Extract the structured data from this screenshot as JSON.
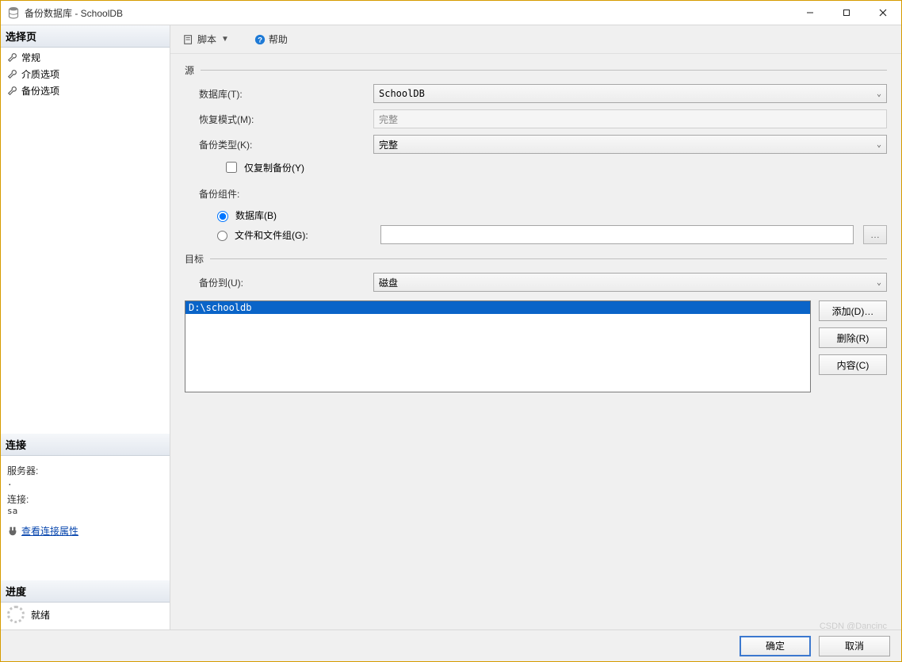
{
  "window": {
    "title": "备份数据库 - SchoolDB"
  },
  "sidebar": {
    "select_page_header": "选择页",
    "pages": [
      {
        "label": "常规"
      },
      {
        "label": "介质选项"
      },
      {
        "label": "备份选项"
      }
    ],
    "connection_header": "连接",
    "server_label": "服务器:",
    "server_value": ".",
    "connection_label": "连接:",
    "connection_value": "sa",
    "view_conn_props": "查看连接属性",
    "progress_header": "进度",
    "progress_status": "就绪"
  },
  "toolbar": {
    "script_label": "脚本",
    "help_label": "帮助"
  },
  "source": {
    "section_title": "源",
    "database_label": "数据库(T):",
    "database_value": "SchoolDB",
    "recovery_model_label": "恢复模式(M):",
    "recovery_model_value": "完整",
    "backup_type_label": "备份类型(K):",
    "backup_type_value": "完整",
    "copy_only_label": "仅复制备份(Y)",
    "component_label": "备份组件:",
    "radio_db_label": "数据库(B)",
    "radio_files_label": "文件和文件组(G):"
  },
  "destination": {
    "section_title": "目标",
    "backup_to_label": "备份到(U):",
    "backup_to_value": "磁盘",
    "list_item": "D:\\schooldb",
    "add_label": "添加(D)…",
    "remove_label": "删除(R)",
    "contents_label": "内容(C)"
  },
  "footer": {
    "ok": "确定",
    "cancel": "取消"
  },
  "watermark": "CSDN @Dancinc"
}
